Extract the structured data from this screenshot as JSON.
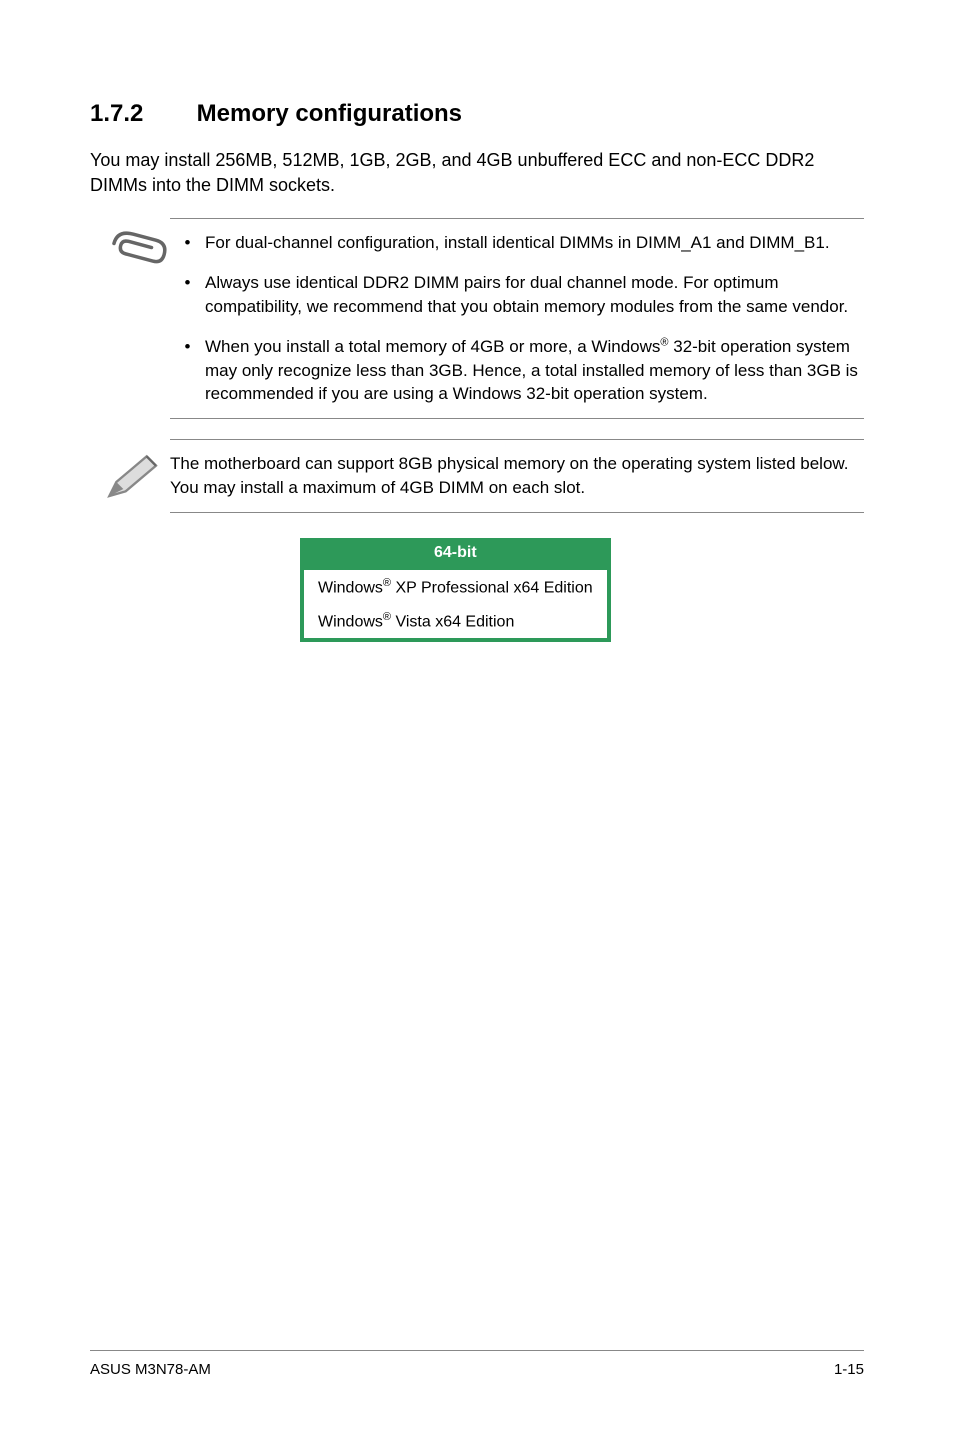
{
  "heading": {
    "number": "1.7.2",
    "title": "Memory configurations"
  },
  "intro": "You may install 256MB, 512MB, 1GB, 2GB, and 4GB unbuffered ECC and non-ECC DDR2 DIMMs into the DIMM sockets.",
  "note1": {
    "bullets": [
      "For dual-channel configuration, install identical DIMMs in DIMM_A1 and DIMM_B1.",
      "Always use identical DDR2 DIMM pairs for dual channel mode. For optimum compatibility, we recommend that you obtain memory modules from the same vendor.",
      "When you install a total memory of 4GB or more, a Windows® 32-bit operation system may only recognize less than 3GB. Hence, a total installed memory of less than 3GB is recommended if you are using a Windows 32-bit operation system."
    ]
  },
  "note2": {
    "text": "The motherboard can support 8GB physical memory on the operating system listed below. You may install a maximum of 4GB DIMM on each slot."
  },
  "table": {
    "header": "64-bit",
    "rows": [
      "Windows® XP Professional x64 Edition",
      "Windows® Vista x64 Edition"
    ]
  },
  "footer": {
    "left": "ASUS M3N78-AM",
    "right": "1-15"
  }
}
